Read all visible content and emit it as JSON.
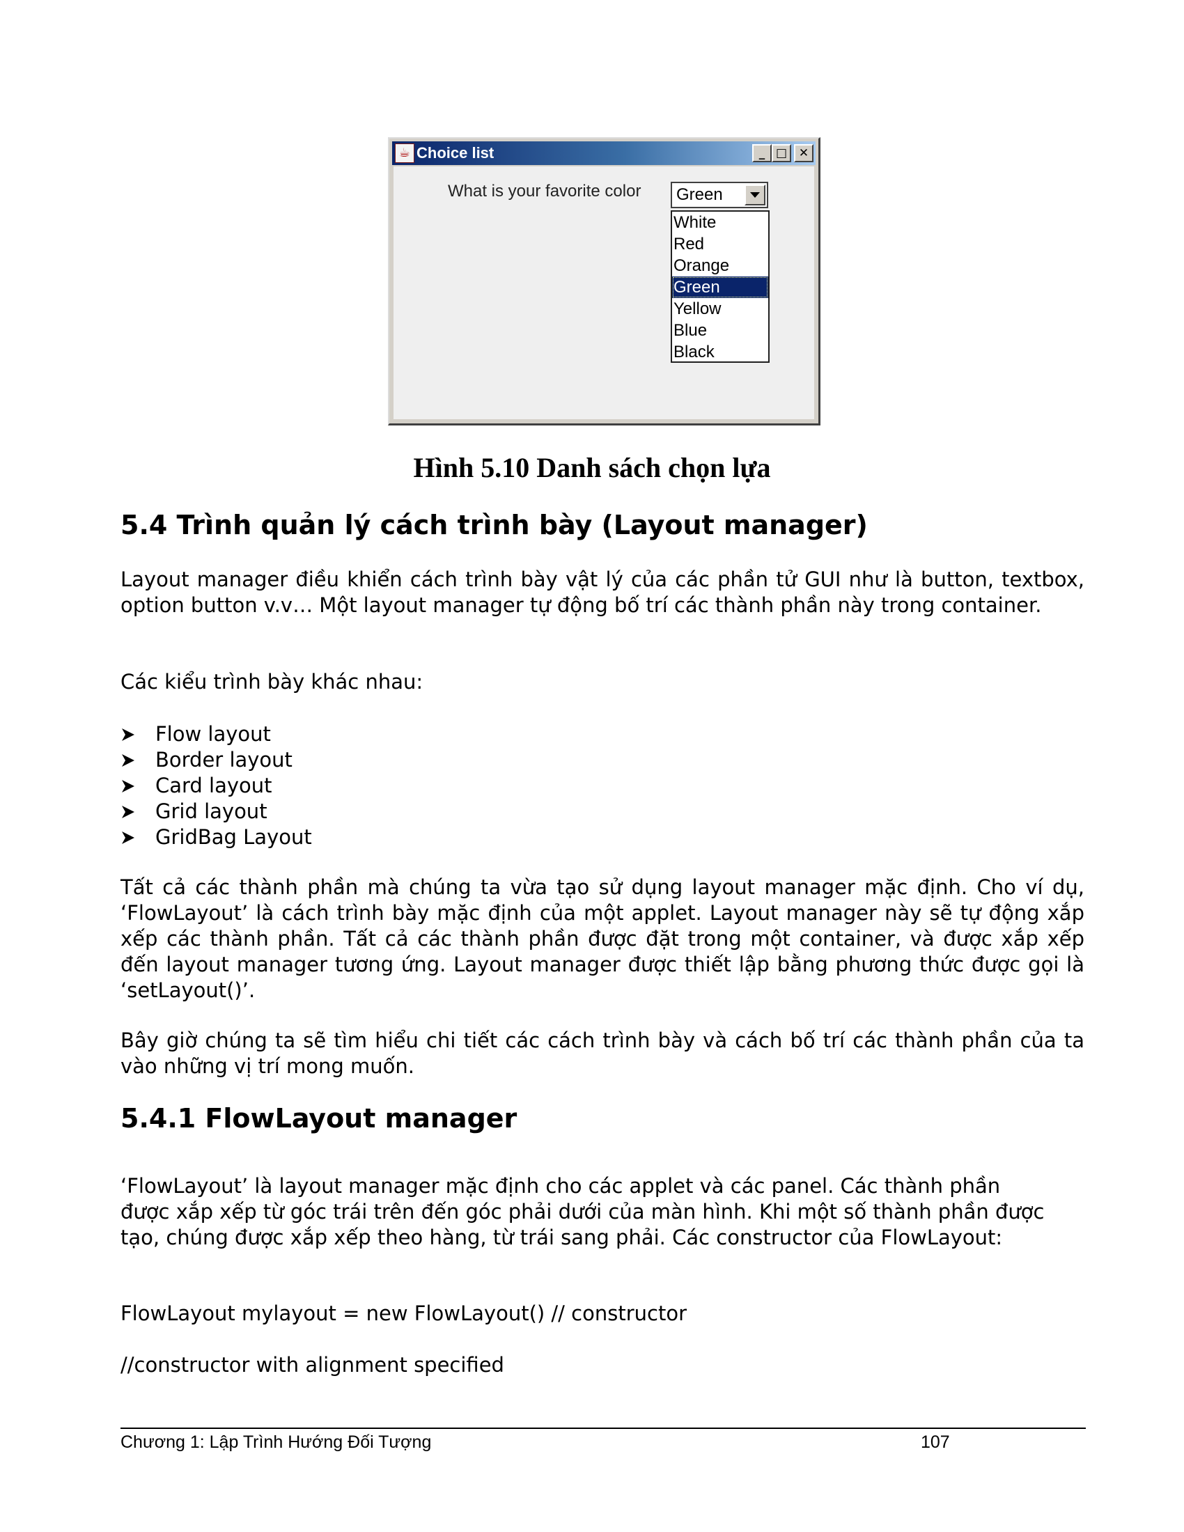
{
  "window": {
    "title": "Choice list",
    "app_icon": "java-coffee-cup-icon",
    "buttons": {
      "minimize": "_",
      "maximize": "□",
      "close": "✕"
    },
    "prompt": "What is your favorite color",
    "choice": {
      "selected": "Green",
      "options": [
        "White",
        "Red",
        "Orange",
        "Green",
        "Yellow",
        "Blue",
        "Black"
      ],
      "highlighted_index": 3
    }
  },
  "caption": "Hình 5.10 Danh sách chọn lựa",
  "section": {
    "heading": "5.4 Trình quản lý cách trình bày (Layout manager)",
    "p1": "Layout manager điều khiển cách trình bày vật lý của các phần tử GUI như là button, textbox, option button v.v… Một layout manager tự động bố trí các thành phần này trong container.",
    "p2": "Các kiểu trình bày khác nhau:",
    "bullets": [
      "Flow layout",
      "Border layout",
      "Card layout",
      "Grid layout",
      "GridBag Layout"
    ],
    "p3": "Tất cả các thành phần mà chúng ta vừa tạo sử dụng layout manager mặc định. Cho ví dụ, ‘FlowLayout’ là cách trình bày mặc định của một applet. Layout manager này sẽ tự động xắp xếp các thành phần. Tất cả các thành phần được đặt trong một container, và được xắp xếp đến layout manager tương ứng. Layout manager được thiết lập bằng phương thức được gọi là ‘setLayout()’.",
    "p4": "Bây giờ chúng ta sẽ tìm hiểu chi tiết các cách trình bày và cách bố trí các thành phần của ta vào những vị trí mong muốn."
  },
  "subsection": {
    "heading": "5.4.1 FlowLayout manager",
    "p1": "‘FlowLayout’ là layout manager mặc định cho các applet và các panel. Các thành phần được xắp xếp từ góc trái trên đến góc phải dưới của màn hình. Khi một số thành phần được tạo, chúng được xắp xếp theo hàng, từ trái sang phải. Các constructor của FlowLayout:",
    "code1": "FlowLayout mylayout = new FlowLayout() // constructor",
    "code2": "//constructor with alignment specified"
  },
  "footer": {
    "chapter": "Chương 1: Lập Trình Hướng Đối Tượng",
    "page": "107"
  }
}
